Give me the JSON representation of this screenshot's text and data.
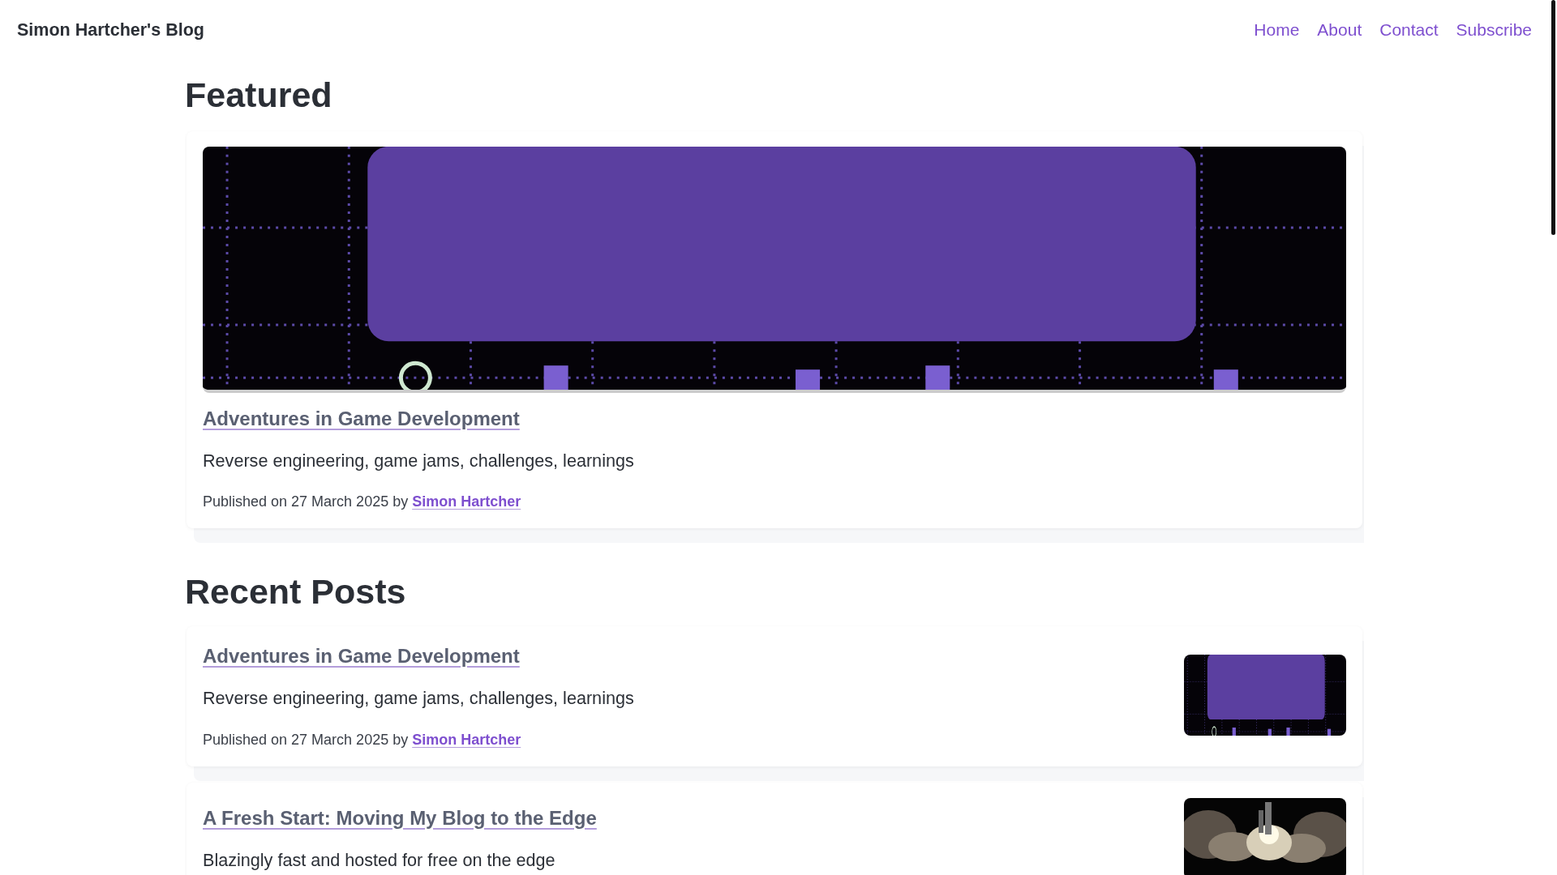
{
  "site_title": "Simon Hartcher's Blog",
  "nav": [
    {
      "label": "Home"
    },
    {
      "label": "About"
    },
    {
      "label": "Contact"
    },
    {
      "label": "Subscribe"
    }
  ],
  "featured": {
    "heading": "Featured",
    "post": {
      "title": "Adventures in Game Development",
      "description": "Reverse engineering, game jams, challenges, learnings",
      "meta": {
        "text": "Published on 27 March 2025 by",
        "author": "Simon Hartcher"
      }
    }
  },
  "recent": {
    "heading": "Recent Posts",
    "posts": [
      {
        "title": "Adventures in Game Development",
        "description": "Reverse engineering, game jams, challenges, learnings",
        "meta": {
          "text": "Published on 27 March 2025 by",
          "author": "Simon Hartcher"
        }
      },
      {
        "title": "A Fresh Start: Moving My Blog to the Edge",
        "description": "Blazingly fast and hosted for free on the edge"
      }
    ]
  }
}
